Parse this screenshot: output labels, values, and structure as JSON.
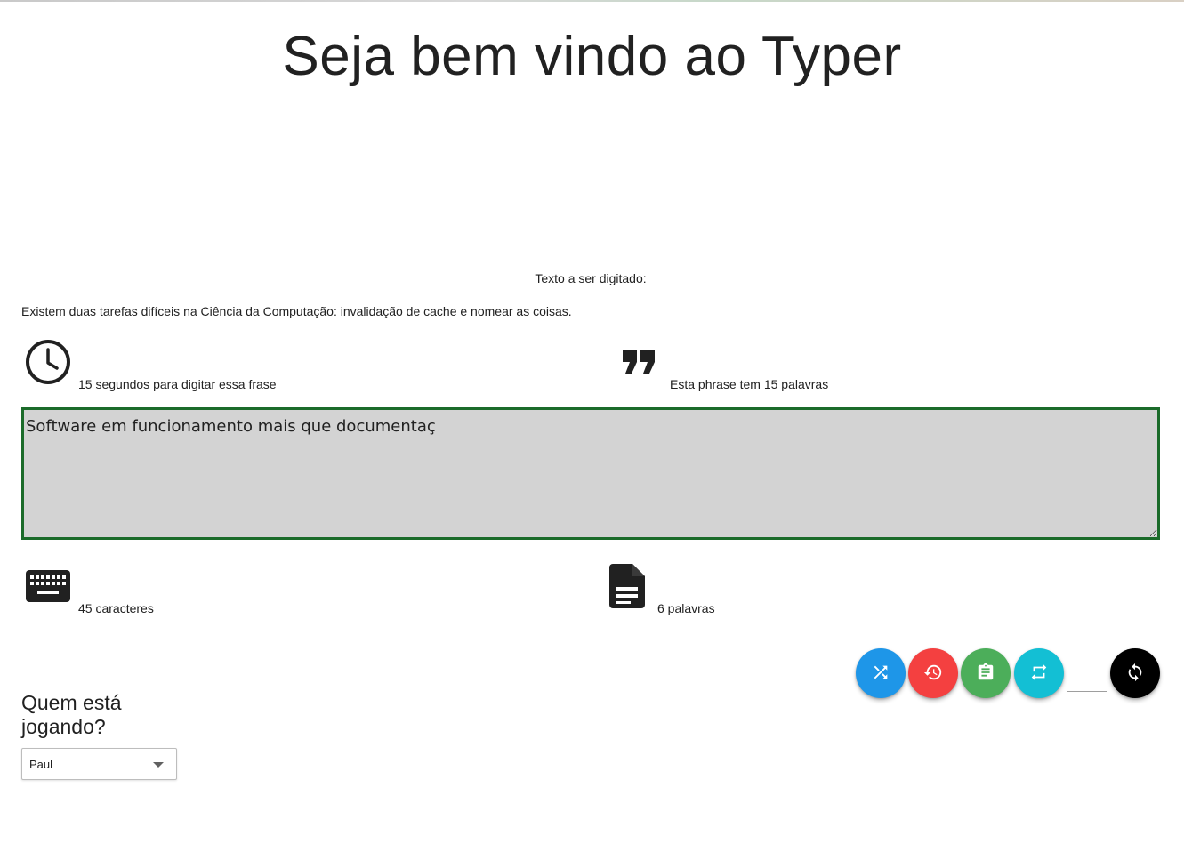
{
  "header": {
    "title": "Seja bem vindo ao Typer"
  },
  "prompt": {
    "label": "Texto a ser digitado:",
    "phrase": "Existem duas tarefas difíceis na Ciência da Computação: invalidação de cache e nomear as coisas."
  },
  "phrase_stats": {
    "time_icon": "clock-icon",
    "time_text": "15 segundos para digitar essa frase",
    "words_icon": "quote-icon",
    "words_text": "Esta phrase tem 15 palavras"
  },
  "typing": {
    "value": "Software em funcionamento mais que documentaç",
    "border_color": "#1b6b2a",
    "background": "#d3d3d3"
  },
  "typed_stats": {
    "chars_icon": "keyboard-icon",
    "chars_text": "45 caracteres",
    "words_icon": "document-icon",
    "words_text": "6 palavras"
  },
  "actions": [
    {
      "name": "shuffle-button",
      "icon": "shuffle-icon",
      "color": "#1e96e8"
    },
    {
      "name": "history-button",
      "icon": "history-icon",
      "color": "#f44040"
    },
    {
      "name": "clipboard-button",
      "icon": "clipboard-icon",
      "color": "#4cae5a"
    },
    {
      "name": "repeat-button",
      "icon": "repeat-icon",
      "color": "#13bfd4"
    },
    {
      "name": "restart-button",
      "icon": "sync-icon",
      "color": "#000000"
    }
  ],
  "player": {
    "heading": "Quem está jogando?",
    "selected": "Paul"
  }
}
